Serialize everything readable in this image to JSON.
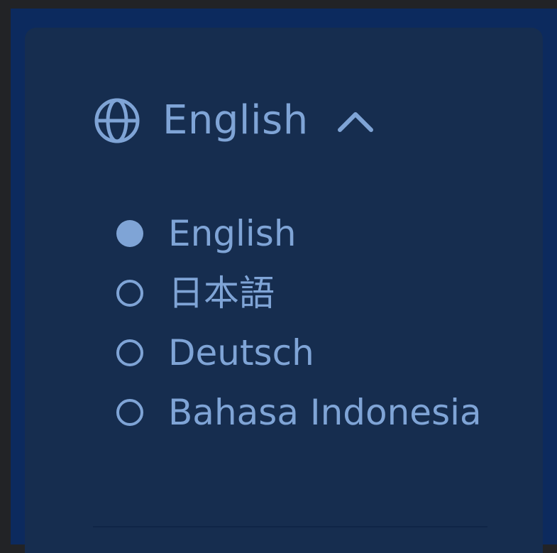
{
  "language_menu": {
    "current_label": "English",
    "toggle_icon": "globe-icon",
    "chevron_icon": "chevron-up-icon",
    "options": [
      {
        "label": "English",
        "selected": true
      },
      {
        "label": "日本語",
        "selected": false
      },
      {
        "label": "Deutsch",
        "selected": false
      },
      {
        "label": "Bahasa Indonesia",
        "selected": false
      }
    ]
  },
  "colors": {
    "background": "#222326",
    "frame": "#0c2a5e",
    "panel": "#162d4f",
    "accent": "#7fa4d6"
  }
}
